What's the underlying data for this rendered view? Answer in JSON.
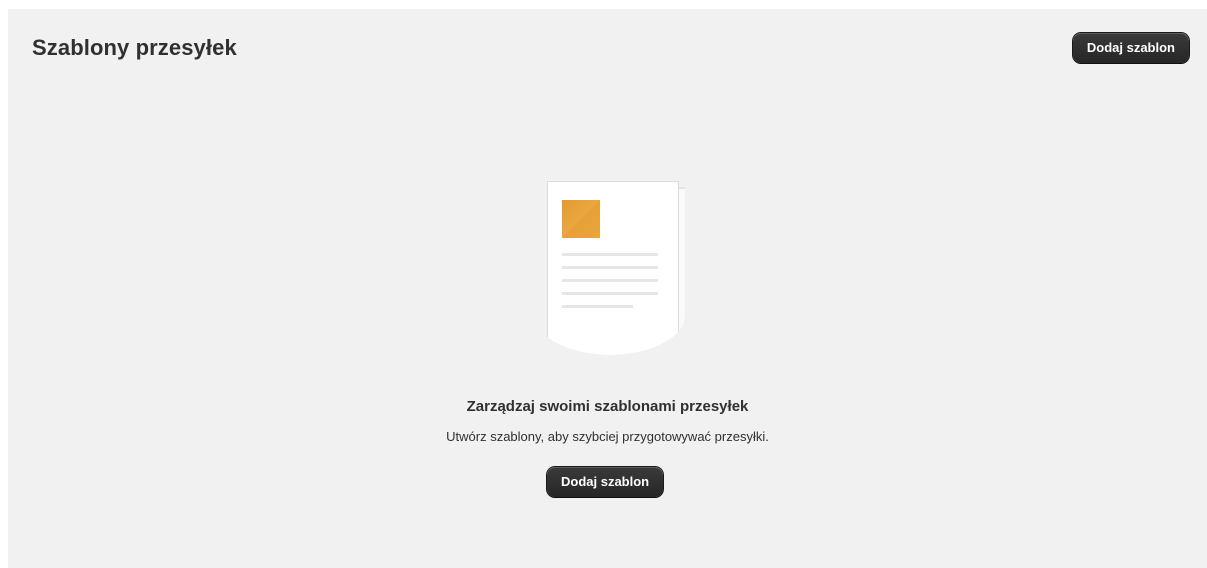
{
  "header": {
    "title": "Szablony przesyłek",
    "add_button_label": "Dodaj szablon"
  },
  "empty_state": {
    "illustration_icon": "document-template-icon",
    "heading": "Zarządzaj swoimi szablonami przesyłek",
    "description": "Utwórz szablony, aby szybciej przygotowywać przesyłki.",
    "action_label": "Dodaj szablon"
  },
  "colors": {
    "background": "#f1f1f1",
    "button": "#303030",
    "accent": "#e8a33d"
  }
}
